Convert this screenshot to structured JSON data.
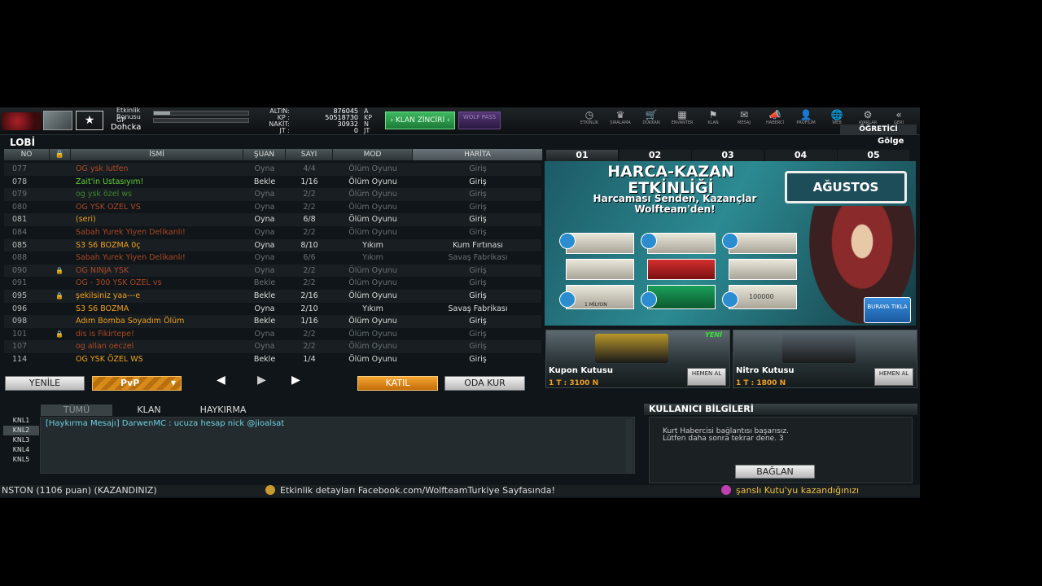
{
  "header": {
    "event_bonus_label": "Etkinlik Bonusu",
    "event_bonus_progress": 0.17,
    "gp_label": "GP",
    "gp_progress": 0.0,
    "nickname": "Dohcka",
    "currencies": [
      {
        "label": "ALTIN:",
        "value": "876045",
        "unit": "A"
      },
      {
        "label": "KP :",
        "value": "50518730",
        "unit": "KP"
      },
      {
        "label": "NAKİT:",
        "value": "30932",
        "unit": "N"
      },
      {
        "label": "JT :",
        "value": "0",
        "unit": "JT"
      }
    ],
    "klan_button": "› KLAN ZİNCİRİ ‹",
    "wolf_pass_button": "WOLF PASS",
    "nav": [
      {
        "label": "ETKİNLİK",
        "glyph": "◷",
        "icon": "clock-icon"
      },
      {
        "label": "SIRALAMA",
        "glyph": "♛",
        "icon": "ranking-icon"
      },
      {
        "label": "DÜKKAN",
        "glyph": "🛒",
        "icon": "cart-icon"
      },
      {
        "label": "ENVANTER",
        "glyph": "▦",
        "icon": "inventory-icon"
      },
      {
        "label": "KLAN",
        "glyph": "⚑",
        "icon": "clan-icon"
      },
      {
        "label": "MESAJ",
        "glyph": "✉",
        "icon": "mail-icon"
      },
      {
        "label": "HABERCİ",
        "glyph": "📣",
        "icon": "megaphone-icon"
      },
      {
        "label": "PROFİLİM",
        "glyph": "👤",
        "icon": "profile-icon"
      },
      {
        "label": "WEB",
        "glyph": "🌐",
        "icon": "globe-icon"
      },
      {
        "label": "AYARLAR",
        "glyph": "⚙",
        "icon": "gear-icon"
      },
      {
        "label": "GERİ",
        "glyph": "«",
        "icon": "back-icon"
      }
    ],
    "tutorial_button": "ÖĞRETİCİ"
  },
  "lobby": {
    "title": "LOBİ",
    "columns": {
      "no": "NO",
      "name": "İSMİ",
      "status": "ŞUAN",
      "count": "SAYI",
      "mode": "MOD",
      "map": "HARİTA"
    },
    "rooms": [
      {
        "no": "077",
        "lock": false,
        "name": "OG ysk lutfen",
        "status": "Oyna",
        "count": "4/4",
        "mode": "Ölüm Oyunu",
        "map": "Giriş",
        "color": "#e0582a",
        "dim": true
      },
      {
        "no": "078",
        "lock": false,
        "name": "Zait'in Ustasıyım!",
        "status": "Bekle",
        "count": "1/16",
        "mode": "Ölüm Oyunu",
        "map": "Giriş",
        "color": "#66d23a",
        "dim": false
      },
      {
        "no": "079",
        "lock": false,
        "name": "og ysk özel ws",
        "status": "Oyna",
        "count": "2/2",
        "mode": "Ölüm Oyunu",
        "map": "Giriş",
        "color": "#4fa834",
        "dim": true
      },
      {
        "no": "080",
        "lock": false,
        "name": "OG YSK ÖZEL VS",
        "status": "Oyna",
        "count": "2/2",
        "mode": "Ölüm Oyunu",
        "map": "Giriş",
        "color": "#e0582a",
        "dim": true
      },
      {
        "no": "081",
        "lock": false,
        "name": "(seri)",
        "status": "Oyna",
        "count": "6/8",
        "mode": "Ölüm Oyunu",
        "map": "Giriş",
        "color": "#f0a020",
        "dim": false
      },
      {
        "no": "084",
        "lock": false,
        "name": "Sabah Yurek Yiyen Delikanlı!",
        "status": "Oyna",
        "count": "2/2",
        "mode": "Ölüm Oyunu",
        "map": "Giriş",
        "color": "#e0582a",
        "dim": true
      },
      {
        "no": "085",
        "lock": false,
        "name": "S3 S6 BOZMA 0ç",
        "status": "Oyna",
        "count": "8/10",
        "mode": "Yıkım",
        "map": "Kum Fırtınası",
        "color": "#f0a020",
        "dim": false
      },
      {
        "no": "088",
        "lock": false,
        "name": "Sabah Yurek Yiyen Delikanlı!",
        "status": "Oyna",
        "count": "6/6",
        "mode": "Yıkım",
        "map": "Savaş Fabrikası",
        "color": "#e0582a",
        "dim": true
      },
      {
        "no": "090",
        "lock": true,
        "name": "OG NINJA YSK",
        "status": "Oyna",
        "count": "2/2",
        "mode": "Ölüm Oyunu",
        "map": "Giriş",
        "color": "#e0582a",
        "dim": true
      },
      {
        "no": "091",
        "lock": false,
        "name": "OG - 300 YSK ÖZEL vs",
        "status": "Bekle",
        "count": "2/2",
        "mode": "Ölüm Oyunu",
        "map": "Giriş",
        "color": "#e0582a",
        "dim": true
      },
      {
        "no": "095",
        "lock": true,
        "name": "şekilsiniz yaa---e",
        "status": "Bekle",
        "count": "2/16",
        "mode": "Ölüm Oyunu",
        "map": "Giriş",
        "color": "#f0a020",
        "dim": false
      },
      {
        "no": "096",
        "lock": false,
        "name": "S3 S6 BOZMA",
        "status": "Oyna",
        "count": "2/10",
        "mode": "Yıkım",
        "map": "Savaş Fabrikası",
        "color": "#f0a020",
        "dim": false
      },
      {
        "no": "098",
        "lock": false,
        "name": "Adım Bomba Soyadım Ölüm",
        "status": "Bekle",
        "count": "1/16",
        "mode": "Ölüm Oyunu",
        "map": "Giriş",
        "color": "#f0a020",
        "dim": false
      },
      {
        "no": "101",
        "lock": true,
        "name": "dis is Fikirtepe!",
        "status": "Oyna",
        "count": "2/2",
        "mode": "Ölüm Oyunu",
        "map": "Giriş",
        "color": "#e0582a",
        "dim": true
      },
      {
        "no": "107",
        "lock": false,
        "name": "og allan oeczel",
        "status": "Oyna",
        "count": "2/2",
        "mode": "Ölüm Oyunu",
        "map": "Giriş",
        "color": "#e0582a",
        "dim": true
      },
      {
        "no": "114",
        "lock": false,
        "name": "OG YSK ÖZEL WS",
        "status": "Bekle",
        "count": "1/4",
        "mode": "Ölüm Oyunu",
        "map": "Giriş",
        "color": "#f0a020",
        "dim": false
      }
    ],
    "refresh_button": "YENİLE",
    "mode_select": "PvP",
    "join_button": "KATIL",
    "create_room_button": "ODA KUR"
  },
  "banner": {
    "tabs": [
      "01",
      "02",
      "03",
      "04",
      "05"
    ],
    "active_tab": 0,
    "shadow_label": "Gölge",
    "title": "HARCA-KAZAN ETKİNLİĞİ",
    "subtitle": "Harcaması Senden, Kazançlar Wolfteam'den!",
    "month": "AĞUSTOS",
    "prize_label": "1 MİLYON",
    "prize_count": "100000",
    "cta": "BURAYA TIKLA"
  },
  "boxes": [
    {
      "name": "Kupon Kutusu",
      "price": "1 T : 3100 N",
      "buy": "HEMEN AL",
      "new": "YENİ",
      "chest_color": "#b8962a"
    },
    {
      "name": "Nitro Kutusu",
      "price": "1 T : 1800 N",
      "buy": "HEMEN AL",
      "new": "",
      "chest_color": "#55606a"
    }
  ],
  "chat": {
    "tabs": [
      "TÜMÜ",
      "KLAN",
      "HAYKIRMA"
    ],
    "channels": [
      "KNL1",
      "KNL2",
      "KNL3",
      "KNL4",
      "KNL5"
    ],
    "active_channel": 1,
    "messages": [
      "[Haykırma Mesajı] DarwenMC : ucuza hesap nick @jioalsat"
    ]
  },
  "user_info": {
    "title": "KULLANICI BİLGİLERİ",
    "message_line1": "Kurt Habercisi bağlantısı başarısız.",
    "message_line2": "Lütfen daha sonra tekrar dene. 3",
    "connect_button": "BAĞLAN"
  },
  "ticker": {
    "items": [
      "NSTON (1106 puan) (KAZANDINIZ)",
      "Etkinlik detayları Facebook.com/WolfteamTurkiye Sayfasında!",
      "şanslı Kutu'yu kazandığınızı"
    ]
  }
}
